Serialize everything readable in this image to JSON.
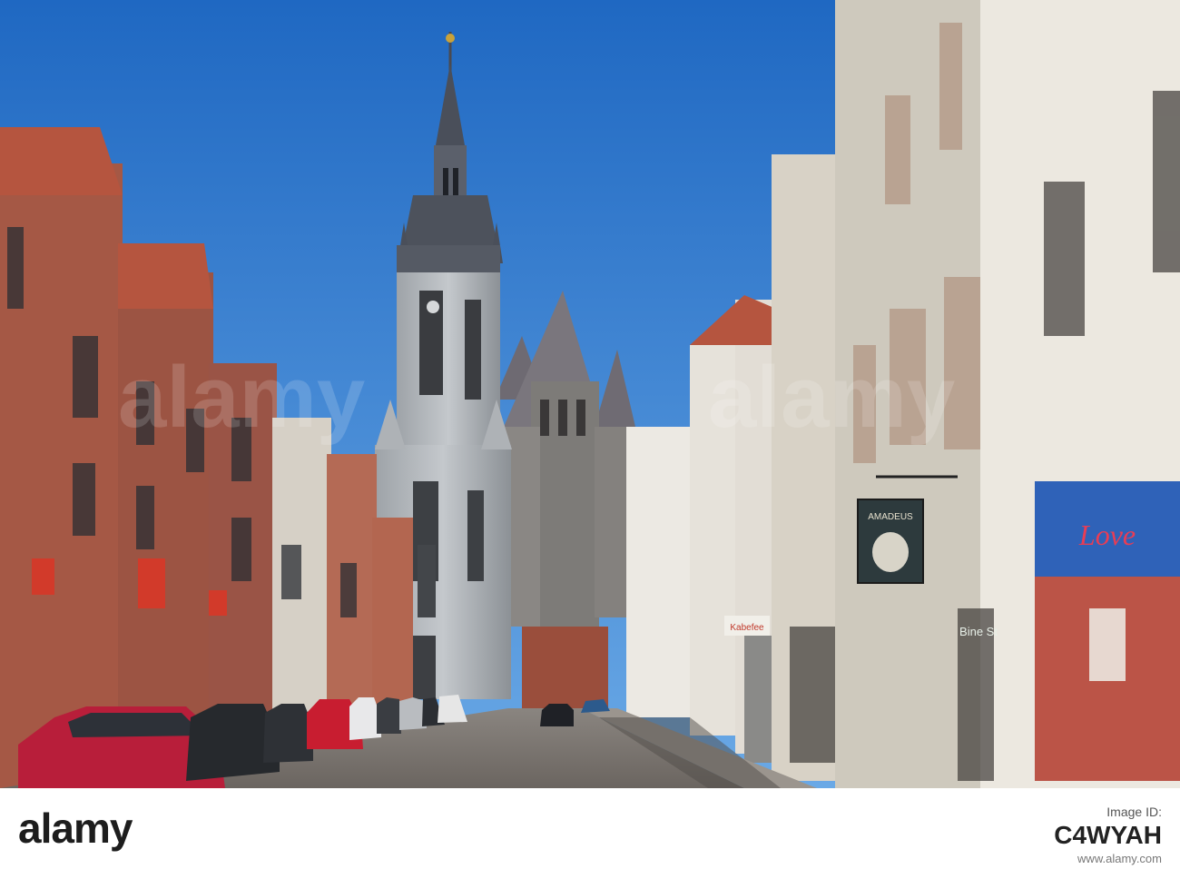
{
  "scene": {
    "description_tag": "street-view-belfry",
    "shop_sign": "AMADEUS",
    "shop_banner": "Love",
    "shop_window_text": "Bine St",
    "store_sign": "Kabefee"
  },
  "watermark": {
    "label": "alamy",
    "logo_name": "alamy-logo"
  },
  "footer": {
    "brand": "alamy",
    "id_label": "Image ID:",
    "image_id": "C4WYAH",
    "url": "www.alamy.com"
  },
  "colors": {
    "sky": "#2f78c8",
    "brick": "#a85a44",
    "stone": "#a8acb0",
    "footer_bg": "#ffffff"
  }
}
